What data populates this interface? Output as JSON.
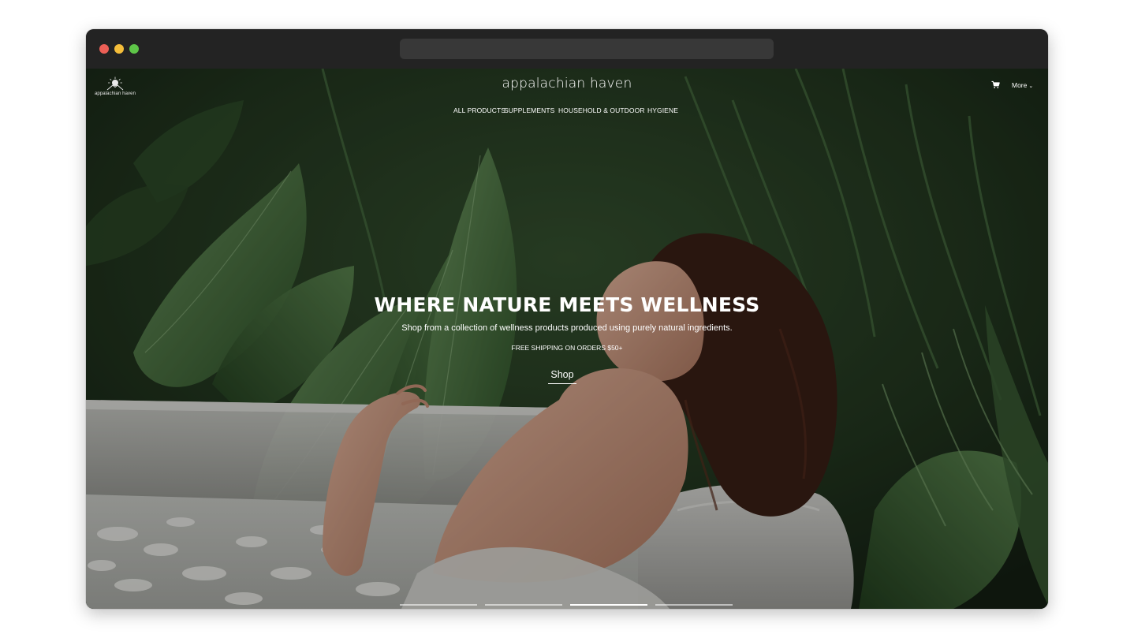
{
  "site": {
    "logo_text": "appalachian haven",
    "brand_title": "appalachian haven"
  },
  "nav": {
    "items": [
      "ALL PRODUCTS",
      "SUPPLEMENTS",
      "HOUSEHOLD & OUTDOOR",
      "HYGIENE"
    ],
    "more_label": "More",
    "cart_icon": "cart-icon"
  },
  "hero": {
    "headline": "WHERE NATURE MEETS WELLNESS",
    "subheadline": "Shop from a collection of wellness products produced using purely natural ingredients.",
    "shipping_note": "FREE SHIPPING ON ORDERS $50+",
    "cta_label": "Shop"
  },
  "slider": {
    "count": 4,
    "active_index": 2
  },
  "colors": {
    "foliage_dark": "#1f3a1f",
    "foliage_mid": "#3f6b3a",
    "foliage_light": "#6f9a62",
    "tub": "#cfcfcc",
    "skin": "#d9a58c",
    "hair": "#3a1f16",
    "text": "#ffffff"
  }
}
